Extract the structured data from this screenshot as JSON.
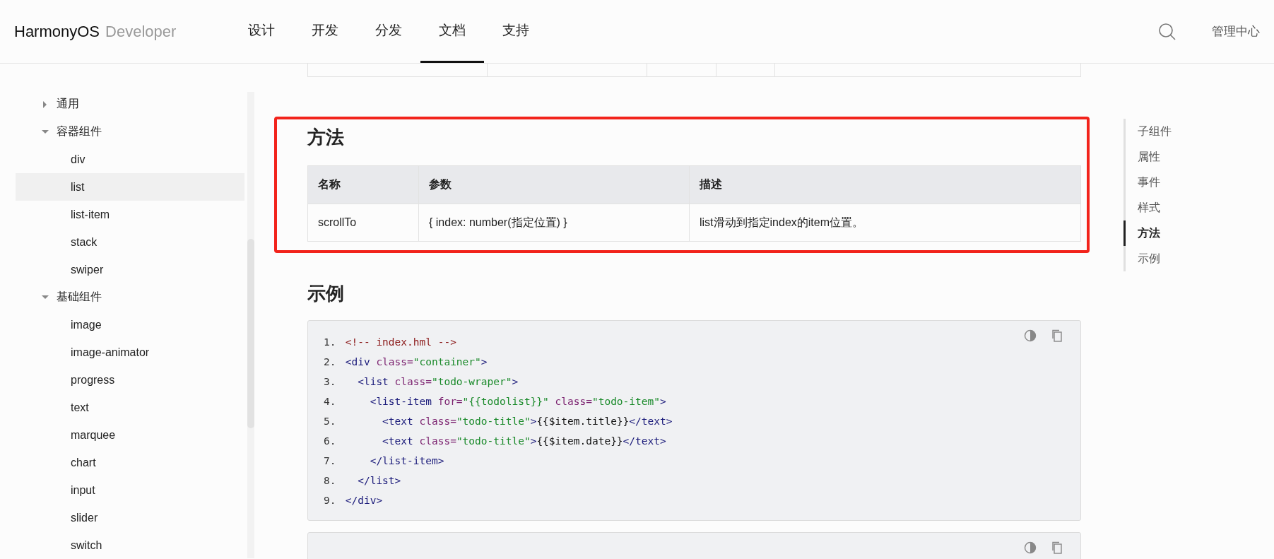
{
  "header": {
    "brand": "HarmonyOS",
    "brand_suffix": "Developer",
    "nav": [
      {
        "label": "设计",
        "selected": false
      },
      {
        "label": "开发",
        "selected": false
      },
      {
        "label": "分发",
        "selected": false
      },
      {
        "label": "文档",
        "selected": true
      },
      {
        "label": "支持",
        "selected": false
      }
    ],
    "account": "管理中心"
  },
  "sidebar": {
    "items": [
      {
        "label": "通用",
        "expanded": false
      },
      {
        "label": "容器组件",
        "expanded": true,
        "children": [
          {
            "label": "div",
            "selected": false
          },
          {
            "label": "list",
            "selected": true
          },
          {
            "label": "list-item",
            "selected": false
          },
          {
            "label": "stack",
            "selected": false
          },
          {
            "label": "swiper",
            "selected": false
          }
        ]
      },
      {
        "label": "基础组件",
        "expanded": true,
        "children": [
          {
            "label": "image",
            "selected": false
          },
          {
            "label": "image-animator",
            "selected": false
          },
          {
            "label": "progress",
            "selected": false
          },
          {
            "label": "text",
            "selected": false
          },
          {
            "label": "marquee",
            "selected": false
          },
          {
            "label": "chart",
            "selected": false
          },
          {
            "label": "input",
            "selected": false
          },
          {
            "label": "slider",
            "selected": false
          },
          {
            "label": "switch",
            "selected": false
          }
        ]
      }
    ]
  },
  "methods": {
    "title": "方法",
    "table": {
      "columns": [
        "名称",
        "参数",
        "描述"
      ],
      "rows": [
        [
          "scrollTo",
          "{ index: number(指定位置) }",
          "list滑动到指定index的item位置。"
        ]
      ]
    }
  },
  "example": {
    "title": "示例",
    "code_blocks": [
      {
        "kind": "full",
        "lines": [
          {
            "number": "1.",
            "tokens": [
              {
                "kind": "comment",
                "text": "<!-- index.hml -->"
              }
            ]
          },
          {
            "number": "2.",
            "tokens": [
              {
                "kind": "tag",
                "text": "<div"
              },
              {
                "kind": "attr",
                "text": " class="
              },
              {
                "kind": "string",
                "text": "\"container\""
              },
              {
                "kind": "tag",
                "text": ">"
              }
            ]
          },
          {
            "number": "3.",
            "tokens": [
              {
                "kind": "tag",
                "text": "  <list"
              },
              {
                "kind": "attr",
                "text": " class="
              },
              {
                "kind": "string",
                "text": "\"todo-wraper\""
              },
              {
                "kind": "tag",
                "text": ">"
              }
            ]
          },
          {
            "number": "4.",
            "tokens": [
              {
                "kind": "tag",
                "text": "    <list-item"
              },
              {
                "kind": "attr",
                "text": " for="
              },
              {
                "kind": "string",
                "text": "\"{{todolist}}\""
              },
              {
                "kind": "attr",
                "text": " class="
              },
              {
                "kind": "string",
                "text": "\"todo-item\""
              },
              {
                "kind": "tag",
                "text": ">"
              }
            ]
          },
          {
            "number": "5.",
            "tokens": [
              {
                "kind": "tag",
                "text": "      <text"
              },
              {
                "kind": "attr",
                "text": " class="
              },
              {
                "kind": "string",
                "text": "\"todo-title\""
              },
              {
                "kind": "tag",
                "text": ">"
              },
              {
                "kind": "plain",
                "text": "{{$item.title}}"
              },
              {
                "kind": "tag",
                "text": "</text>"
              }
            ]
          },
          {
            "number": "6.",
            "tokens": [
              {
                "kind": "tag",
                "text": "      <text"
              },
              {
                "kind": "attr",
                "text": " class="
              },
              {
                "kind": "string",
                "text": "\"todo-title\""
              },
              {
                "kind": "tag",
                "text": ">"
              },
              {
                "kind": "plain",
                "text": "{{$item.date}}"
              },
              {
                "kind": "tag",
                "text": "</text>"
              }
            ]
          },
          {
            "number": "7.",
            "tokens": [
              {
                "kind": "tag",
                "text": "    </list-item>"
              }
            ]
          },
          {
            "number": "8.",
            "tokens": [
              {
                "kind": "tag",
                "text": "  </list>"
              }
            ]
          },
          {
            "number": "9.",
            "tokens": [
              {
                "kind": "tag",
                "text": "</div>"
              }
            ]
          }
        ]
      },
      {
        "kind": "cut_off"
      }
    ]
  },
  "toc": {
    "items": [
      {
        "label": "子组件",
        "selected": false
      },
      {
        "label": "属性",
        "selected": false
      },
      {
        "label": "事件",
        "selected": false
      },
      {
        "label": "样式",
        "selected": false
      },
      {
        "label": "方法",
        "selected": true
      },
      {
        "label": "示例",
        "selected": false
      }
    ]
  }
}
